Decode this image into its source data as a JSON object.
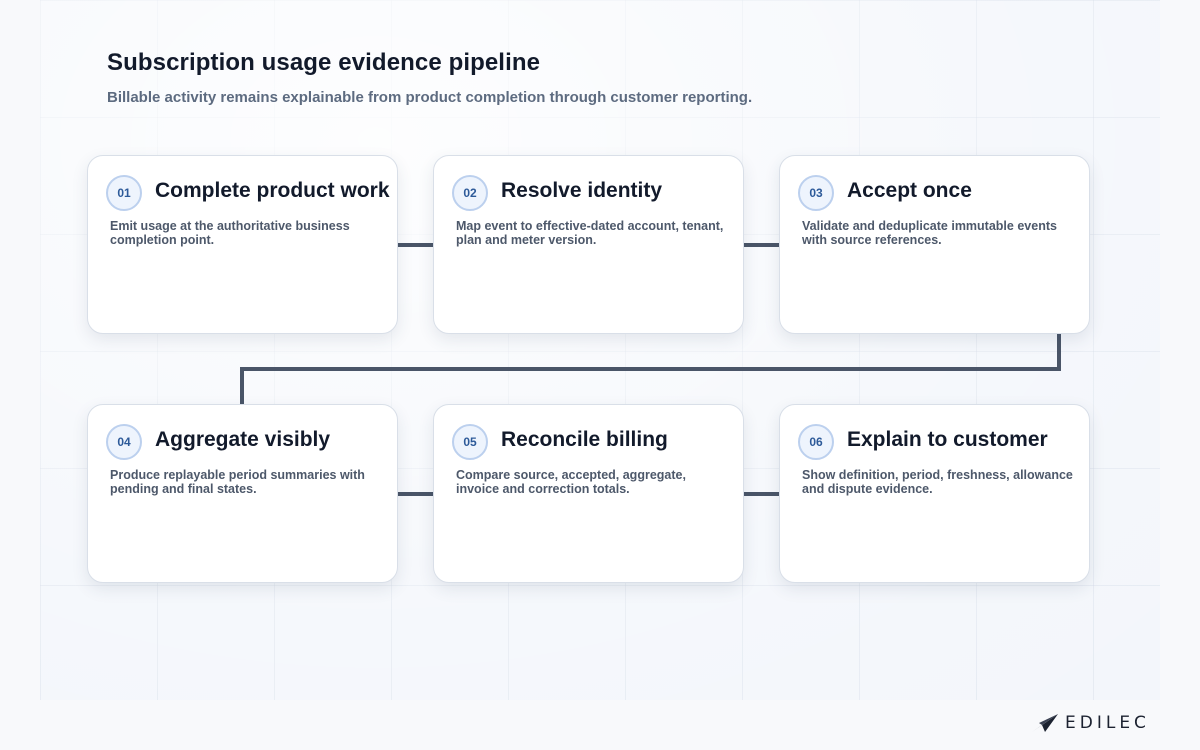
{
  "header": {
    "title": "Subscription usage evidence pipeline",
    "subtitle": "Billable activity remains explainable from product completion through customer reporting."
  },
  "steps": [
    {
      "number": "01",
      "title": "Complete product work",
      "description": "Emit usage at the authoritative business completion point."
    },
    {
      "number": "02",
      "title": "Resolve identity",
      "description": "Map event to effective-dated account, tenant, plan and meter version."
    },
    {
      "number": "03",
      "title": "Accept once",
      "description": "Validate and deduplicate immutable events with source references."
    },
    {
      "number": "04",
      "title": "Aggregate visibly",
      "description": "Produce replayable period summaries with pending and final states."
    },
    {
      "number": "05",
      "title": "Reconcile billing",
      "description": "Compare source, accepted, aggregate, invoice and correction totals."
    },
    {
      "number": "06",
      "title": "Explain to customer",
      "description": "Show definition, period, freshness, allowance and dispute evidence."
    }
  ],
  "brand": {
    "logo_text": "EDILEC",
    "logo_icon": "paper-plane-mark-icon"
  },
  "colors": {
    "connector": "#4a5568",
    "badge_text": "#2d5a99",
    "title_text": "#121a2b"
  }
}
